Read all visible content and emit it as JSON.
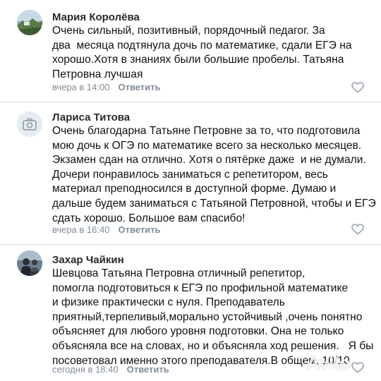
{
  "comments": [
    {
      "author": "Мария Королёва",
      "lines": [
        "Очень сильный, позитивный, порядочный педагог. За",
        "два  месяца подтянула дочь по математике, сдали ЕГЭ на",
        "хорошо.Хотя в знаниях были большие пробелы. Татьяна",
        "Петровна лучшая"
      ],
      "time": "вчера в 14:00",
      "reply_label": "Ответить",
      "avatar_icon": "landscape-photo-avatar",
      "like_icon": "heart-icon"
    },
    {
      "author": "Лариса Титова",
      "lines": [
        "Очень благодарна Татьяне Петровне за то, что подготовила",
        "мою дочь к ОГЭ по математике всего за несколько месяцев.",
        "Экзамен сдан на отлично. Хотя о пятёрке даже  и не думали.",
        "Дочери понравилось заниматься с репетитором, весь",
        "материал преподносился в доступной форме. Думаю и",
        "дальше будем заниматься с Татьяной Петровной, чтобы и ЕГЭ",
        "сдать хорошо. Большое вам спасибо!"
      ],
      "time": "вчера в 16:40",
      "reply_label": "Ответить",
      "avatar_icon": "camera-icon",
      "like_icon": "heart-icon"
    },
    {
      "author": "Захар Чайкин",
      "lines": [
        "Шевцова Татьяна Петровна отличный репетитор,",
        "помогла подготовиться к ЕГЭ по профильной математике",
        "и физике практически с нуля. Преподаватель",
        "приятный,терпеливый,морально устойчивый ,очень понятно",
        "объясняет для любого уровня подготовки. Она не только",
        "объясняла все на словах, но и объясняла ход решения.   Я бы",
        "посоветовал именно этого преподавателя.В общем, 10/10"
      ],
      "time": "сегодня в 18:40",
      "reply_label": "Ответить",
      "avatar_icon": "person-photo-avatar",
      "like_icon": "heart-icon"
    }
  ],
  "watermark": "Avito",
  "colors": {
    "meta": "#818c99",
    "divider": "#d9dbde",
    "author": "#2a2a2a"
  }
}
